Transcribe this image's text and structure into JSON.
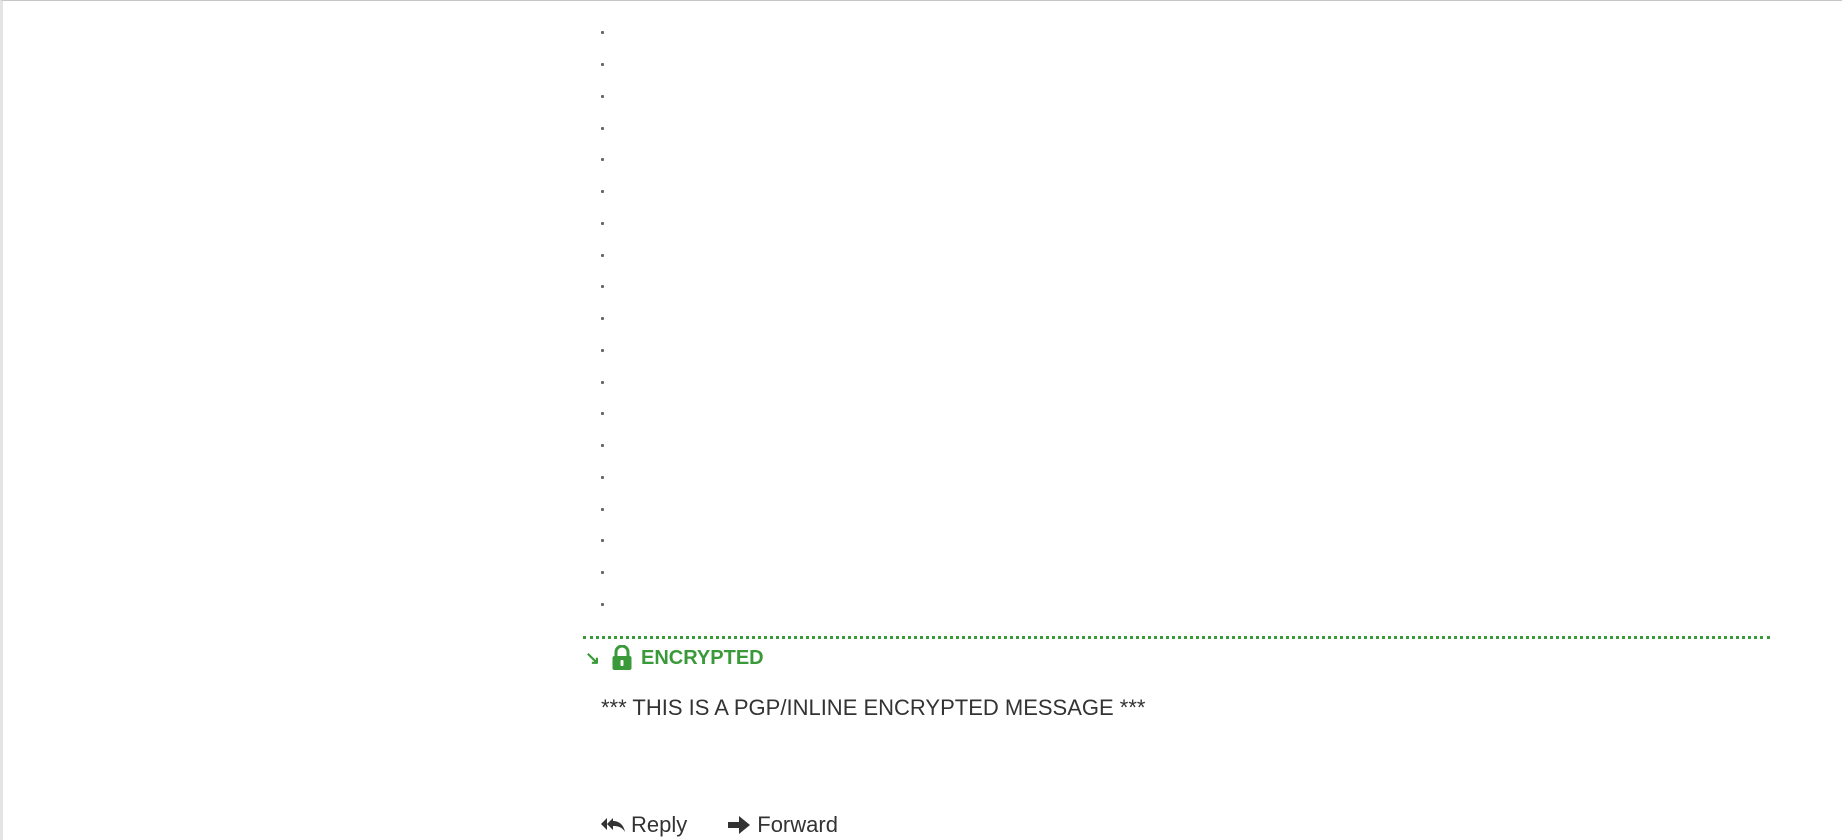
{
  "message": {
    "dot_lines": [
      ".",
      ".",
      ".",
      ".",
      ".",
      ".",
      ".",
      ".",
      ".",
      ".",
      ".",
      ".",
      ".",
      ".",
      ".",
      ".",
      ".",
      ".",
      "."
    ],
    "encryption": {
      "label": "ENCRYPTED",
      "icon": "lock-icon",
      "toggle_icon": "collapse-arrow-icon",
      "color": "#3a9a3a",
      "body_text": "*** THIS IS A PGP/INLINE ENCRYPTED MESSAGE ***"
    }
  },
  "actions": {
    "reply_label": "Reply",
    "reply_icon": "reply-all-icon",
    "forward_label": "Forward",
    "forward_icon": "arrow-right-icon"
  }
}
